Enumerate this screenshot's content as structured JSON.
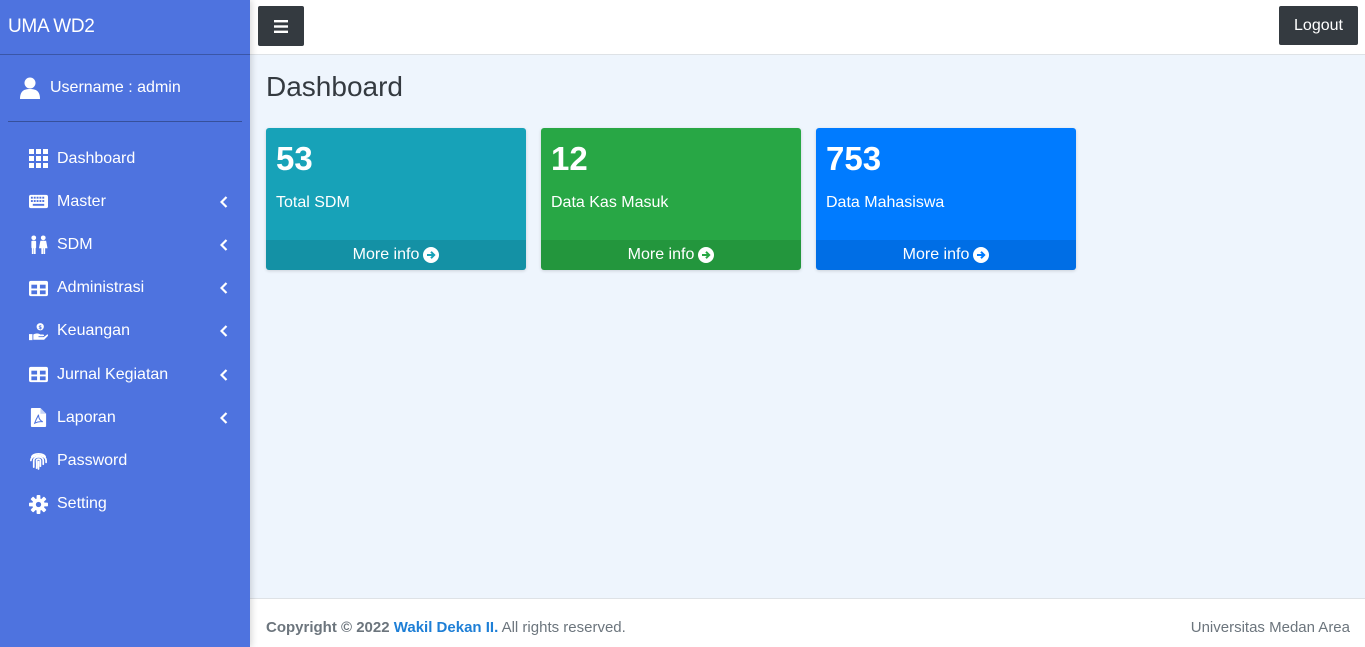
{
  "brand": "UMA WD2",
  "user": {
    "label": "Username : admin"
  },
  "sidebar": {
    "items": [
      {
        "label": "Dashboard",
        "icon": "grid-icon",
        "has_submenu": false
      },
      {
        "label": "Master",
        "icon": "keyboard-icon",
        "has_submenu": true
      },
      {
        "label": "SDM",
        "icon": "people-icon",
        "has_submenu": true
      },
      {
        "label": "Administrasi",
        "icon": "table-icon",
        "has_submenu": true
      },
      {
        "label": "Keuangan",
        "icon": "hand-holding-usd-icon",
        "has_submenu": true
      },
      {
        "label": "Jurnal Kegiatan",
        "icon": "table-icon",
        "has_submenu": true
      },
      {
        "label": "Laporan",
        "icon": "file-pdf-icon",
        "has_submenu": true
      },
      {
        "label": "Password",
        "icon": "fingerprint-icon",
        "has_submenu": false
      },
      {
        "label": "Setting",
        "icon": "gear-icon",
        "has_submenu": false
      }
    ]
  },
  "topbar": {
    "logout_label": "Logout"
  },
  "main": {
    "title": "Dashboard",
    "boxes": [
      {
        "value": "53",
        "caption": "Total SDM",
        "link": "More info",
        "color": "#17a2b8"
      },
      {
        "value": "12",
        "caption": "Data Kas Masuk",
        "link": "More info",
        "color": "#28a745"
      },
      {
        "value": "753",
        "caption": "Data Mahasiswa",
        "link": "More info",
        "color": "#007bff"
      }
    ]
  },
  "footer": {
    "copyright_prefix": "Copyright © 2022",
    "owner": "Wakil Dekan II.",
    "suffix": "All rights reserved.",
    "right_text": "Universitas Medan Area"
  },
  "colors": {
    "sidebar_bg": "#4e73df",
    "dark_button": "#343a40",
    "content_bg": "#eef5fd",
    "link": "#1e7fd6"
  }
}
